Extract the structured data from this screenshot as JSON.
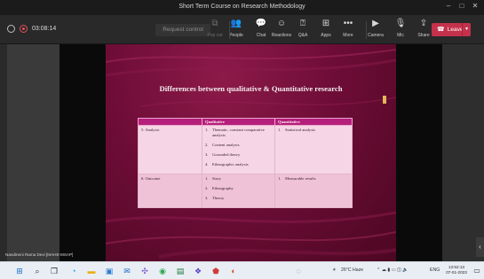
{
  "window": {
    "title": "Short Term Course on Research Methodology",
    "controls": [
      "–",
      "□",
      "✕"
    ]
  },
  "meeting": {
    "timer": "03:08:14",
    "request_control_label": "Request control",
    "tools": [
      {
        "label": "Pop out",
        "icon": "pop-out-icon",
        "glyph": "⧉",
        "dim": true
      },
      {
        "label": "People",
        "icon": "people-icon",
        "glyph": "👥",
        "dim": false
      },
      {
        "label": "Chat",
        "icon": "chat-icon",
        "glyph": "💬",
        "dim": false
      },
      {
        "label": "Reactions",
        "icon": "reactions-icon",
        "glyph": "☺",
        "dim": false
      },
      {
        "label": "Q&A",
        "icon": "qa-icon",
        "glyph": "⍰",
        "dim": false
      },
      {
        "label": "Apps",
        "icon": "apps-icon",
        "glyph": "⊞",
        "dim": false
      },
      {
        "label": "More",
        "icon": "more-icon",
        "glyph": "•••",
        "dim": false
      },
      {
        "label": "Camera",
        "icon": "camera-icon",
        "glyph": "▶",
        "dim": false
      },
      {
        "label": "Mic",
        "icon": "mic-off-icon",
        "glyph": "🎙",
        "dim": false
      },
      {
        "label": "Share",
        "icon": "share-icon",
        "glyph": "⇪",
        "dim": false
      }
    ],
    "leave_label": "Leave",
    "participant_name": "Nandineni Rama Devi [MAHE-MSAP]"
  },
  "slide": {
    "title": "Differences between qualitative & Quantitative research",
    "table": {
      "headers": [
        "",
        "Qualitative",
        "Quantitative"
      ],
      "rows": [
        {
          "label": "5. Analysis",
          "qualitative": [
            {
              "n": "1.",
              "text": "Thematic, constant comparative analysis"
            },
            {
              "n": "2.",
              "text": "Content analysis"
            },
            {
              "n": "3.",
              "text": "Grounded theory"
            },
            {
              "n": "4.",
              "text": "Ethnographic analysis"
            }
          ],
          "quantitative": [
            {
              "n": "1.",
              "text": "Statistical analysis"
            }
          ]
        },
        {
          "label": "6. Outcome",
          "qualitative": [
            {
              "n": "1.",
              "text": "Story"
            },
            {
              "n": "2.",
              "text": "Ethnography"
            },
            {
              "n": "3.",
              "text": "Theory"
            }
          ],
          "quantitative": [
            {
              "n": "1.",
              "text": "Measurable results"
            }
          ]
        }
      ]
    }
  },
  "taskbar": {
    "weather": "26°C  Haze",
    "language": "ENG",
    "time": "12:52:13",
    "date": "07-01-2023"
  },
  "colors": {
    "leave_button": "#c4314b",
    "table_header": "#b51e7a",
    "slide_background": "#6e0d37"
  }
}
